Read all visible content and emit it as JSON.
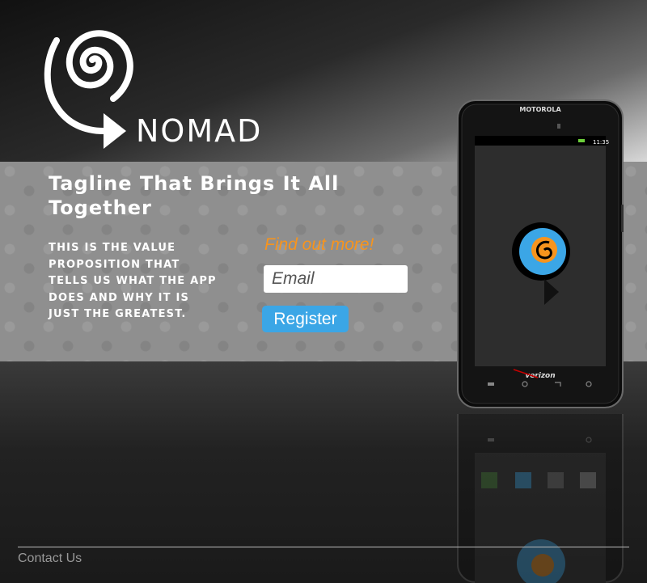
{
  "brand": {
    "name": "NOMAD"
  },
  "hero": {
    "tagline": "Tagline That Brings It All Together",
    "value_proposition": "This is the value proposition that tells us what the app does and why it is just the greatest."
  },
  "signup": {
    "prompt": "Find out more!",
    "email_placeholder": "Email",
    "register_label": "Register"
  },
  "phone": {
    "manufacturer": "MOTOROLA",
    "carrier": "verizon",
    "status_time": "11:35"
  },
  "footer": {
    "contact_label": "Contact Us"
  },
  "colors": {
    "accent_orange": "#f7941d",
    "button_blue": "#3ba6e6",
    "band_gray": "#8f8f8f"
  }
}
